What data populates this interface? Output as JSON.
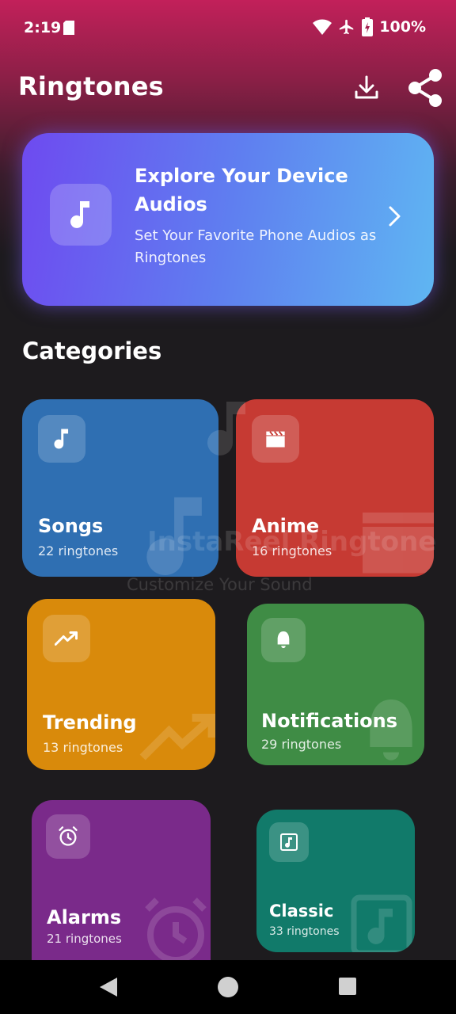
{
  "status_bar": {
    "time": "2:19",
    "battery": "100%",
    "icons": [
      "sd-card-icon",
      "wifi-icon",
      "airplane-icon",
      "battery-icon"
    ]
  },
  "app_bar": {
    "title": "Ringtones",
    "actions": [
      "download-icon",
      "share-icon"
    ]
  },
  "hero": {
    "title": "Explore Your Device Audios",
    "subtitle": "Set Your Favorite Phone Audios as Ringtones",
    "icon": "music-note-icon"
  },
  "categories": {
    "heading": "Categories",
    "items": [
      {
        "name": "Songs",
        "count": "22 ringtones",
        "icon": "music-note-icon",
        "color": "#2f6fb2"
      },
      {
        "name": "Anime",
        "count": "16 ringtones",
        "icon": "clapperboard-icon",
        "color": "#c63a33"
      },
      {
        "name": "Trending",
        "count": "13 ringtones",
        "icon": "trending-up-icon",
        "color": "#d98a0b"
      },
      {
        "name": "Notifications",
        "count": "29 ringtones",
        "icon": "bell-icon",
        "color": "#3f8c45"
      },
      {
        "name": "Alarms",
        "count": "21 ringtones",
        "icon": "alarm-clock-icon",
        "color": "#7a2a8a"
      },
      {
        "name": "Classic",
        "count": "33 ringtones",
        "icon": "music-file-icon",
        "color": "#117a6a"
      }
    ]
  },
  "watermark": {
    "title": "InstaReel Ringtone",
    "subtitle": "Customize Your Sound"
  },
  "nav_bar": {
    "buttons": [
      "back-icon",
      "home-icon",
      "recents-icon"
    ]
  }
}
